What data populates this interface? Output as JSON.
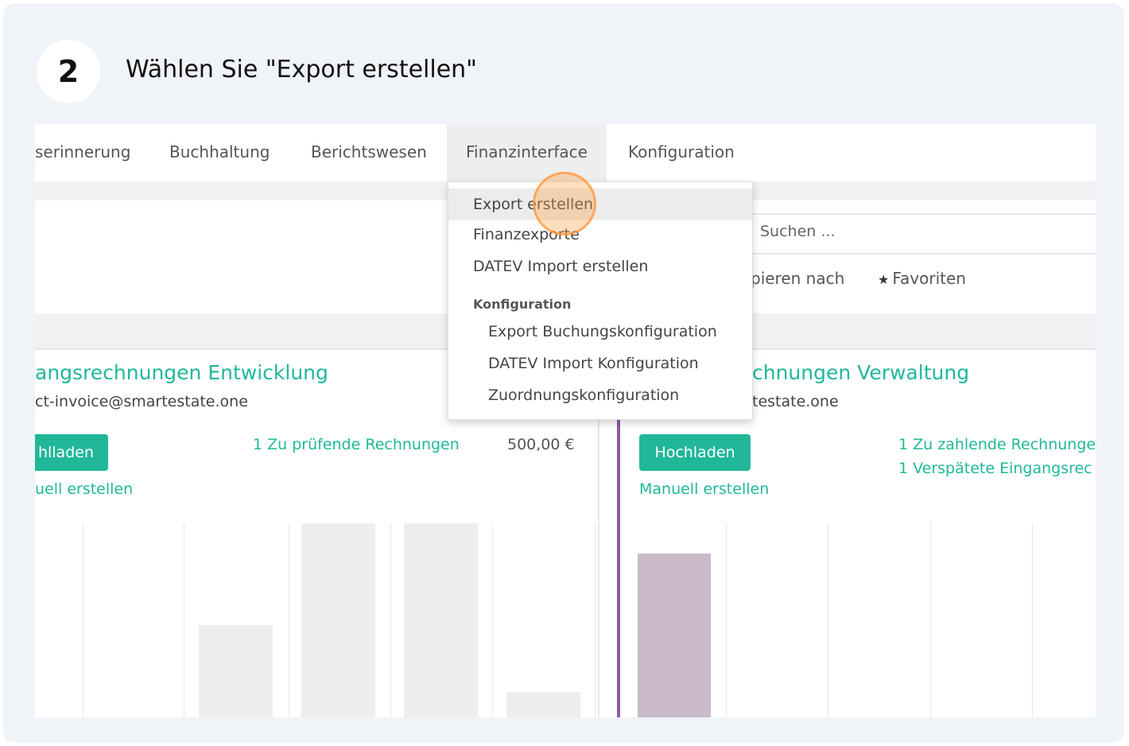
{
  "step": {
    "number": "2",
    "title": "Wählen Sie \"Export erstellen\""
  },
  "menu": {
    "items": [
      "serinnerung",
      "Buchhaltung",
      "Berichtswesen",
      "Finanzinterface",
      "Konfiguration"
    ],
    "active_index": 3
  },
  "search": {
    "placeholder": "Suchen ...",
    "group_label": "pieren nach",
    "favorites_label": "Favoriten"
  },
  "dropdown": {
    "items": [
      "Export erstellen",
      "Finanzexporte",
      "DATEV Import erstellen"
    ],
    "section_header": "Konfiguration",
    "section_items": [
      "Export Buchungskonfiguration",
      "DATEV Import Konfiguration",
      "Zuordnungskonfiguration"
    ],
    "highlighted_item": "Export erstellen"
  },
  "cards": [
    {
      "title": "angsrechnungen Entwicklung",
      "email": "ct-invoice@smartestate.one",
      "upload_label": "hlladen",
      "manual_label": "uell erstellen",
      "stats": [
        "1 Zu prüfende Rechnungen"
      ],
      "amount": "500,00 €"
    },
    {
      "title": "chnungen Verwaltung",
      "email": "testate.one",
      "upload_label": "Hochladen",
      "manual_label": "Manuell erstellen",
      "stats": [
        "1 Zu zahlende Rechnunge",
        "1 Verspätete Eingangsrec"
      ]
    }
  ],
  "colors": {
    "accent": "#21b799",
    "card_border": "#8b5ba8",
    "bar_left": "#eeeeee",
    "bar_right": "#cbbac8",
    "click_marker": "#ffa046"
  },
  "icons": {
    "favorites": "star-icon"
  }
}
